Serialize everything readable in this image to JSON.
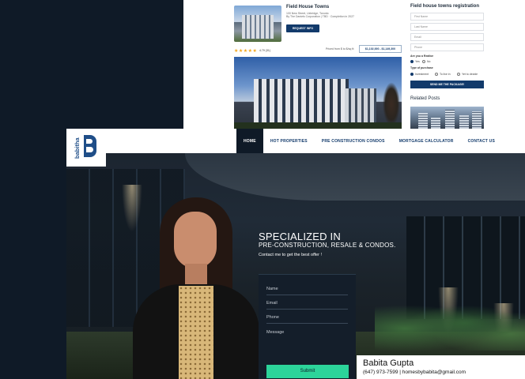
{
  "listing": {
    "title": "Field House Towns",
    "address_line1": "100 New Street, Uxbridge, Toronto",
    "address_line2": "By The Daniels Corporation | TBD · Completion in 2027",
    "request_button": "REQUEST INFO",
    "stars": "★★★★★",
    "rating_text": "4.79 (31)",
    "price_label": "Priced from $ to $/sq ft:",
    "price_range": "$1,102,000 - $1,149,300"
  },
  "registration": {
    "title": "Field house towns registration",
    "fields": [
      "First Name",
      "Last Name",
      "Email",
      "Phone"
    ],
    "realtor_question": "Are you a Realtor",
    "realtor_options": [
      "Yes",
      "No"
    ],
    "purchase_question": "Type of purchase",
    "purchase_options": [
      "Investment",
      "To live in",
      "Yet to decide"
    ],
    "submit_button": "SEND ME THE PACKAGE!"
  },
  "related": {
    "title": "Related Posts"
  },
  "logo": {
    "text": "babitha"
  },
  "nav": {
    "items": [
      "HOME",
      "HOT PROPERTIES",
      "PRE CONSTRUCTION CONDOS",
      "MORTGAGE CALCULATOR",
      "CONTACT US"
    ],
    "active_index": 0
  },
  "hero": {
    "headline": "SPECIALIZED IN",
    "subheadline": "PRE-CONSTRUCTION, RESALE & CONDOS.",
    "cta": "Contact me to get the best offer !"
  },
  "contact_form": {
    "fields": [
      "Name",
      "Email",
      "Phone",
      "Message"
    ],
    "submit_button": "Submit"
  },
  "agent": {
    "name": "Babita Gupta",
    "contact": "(647) 973-7599  |  homesbybabita@gmail.com"
  },
  "colors": {
    "navy": "#123a6b",
    "dark_bg": "#0f1a27",
    "accent_green": "#2cd49a",
    "star_gold": "#f2a51a"
  }
}
